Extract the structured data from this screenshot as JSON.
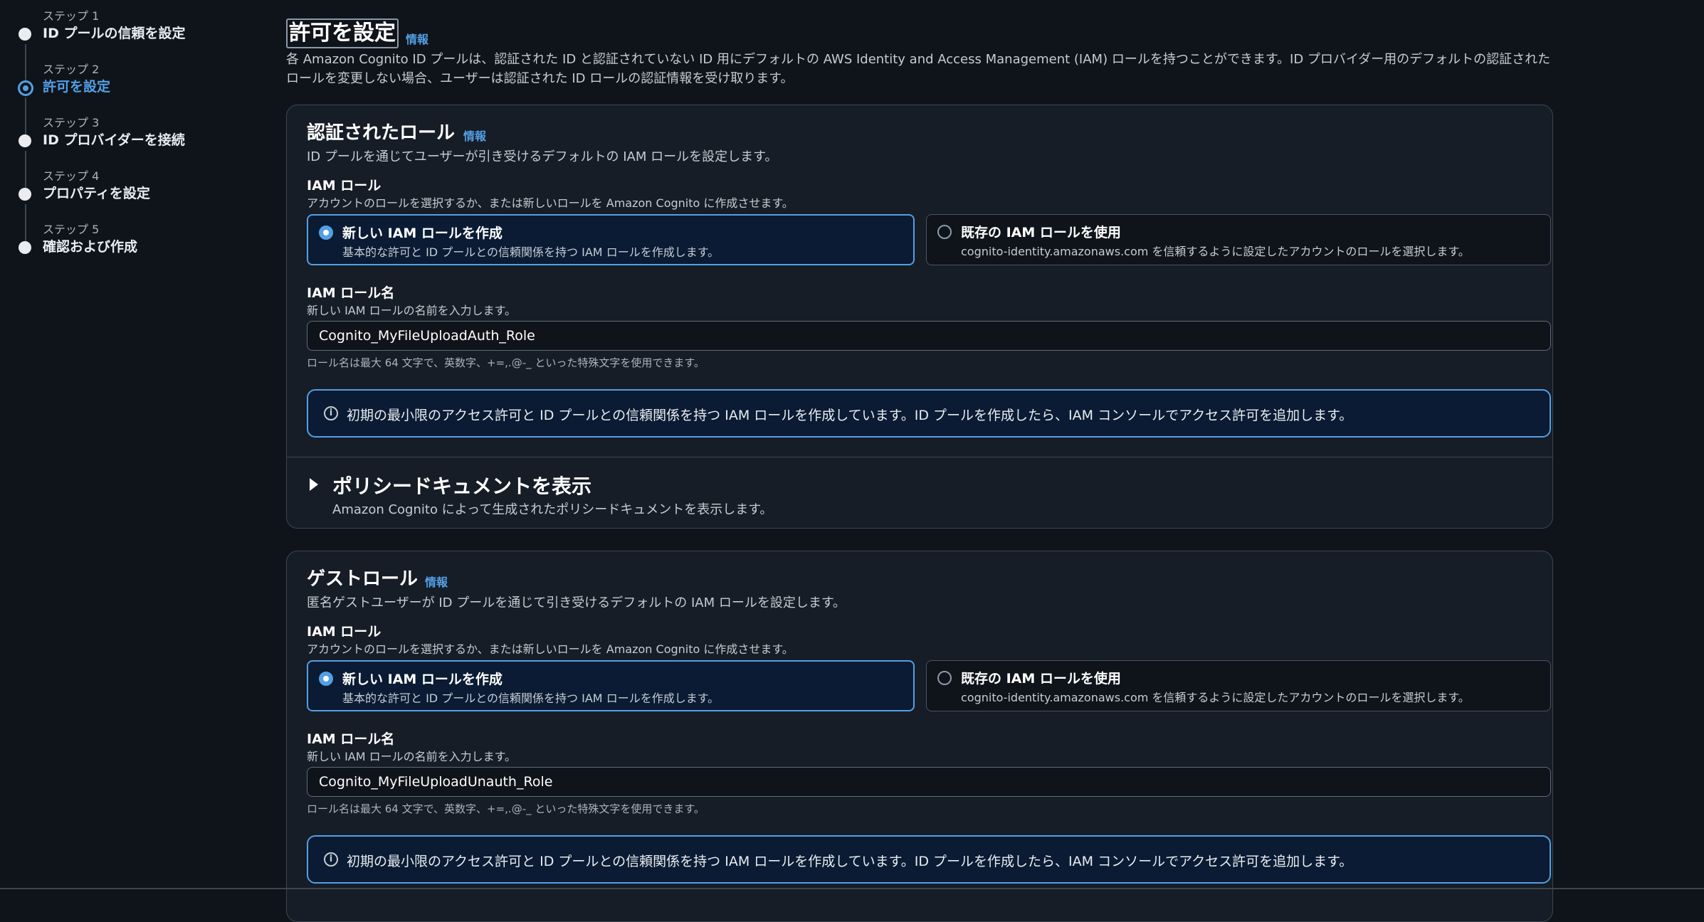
{
  "steps": [
    {
      "label": "ステップ 1",
      "name": "ID プールの信頼を設定"
    },
    {
      "label": "ステップ 2",
      "name": "許可を設定"
    },
    {
      "label": "ステップ 3",
      "name": "ID プロバイダーを接続"
    },
    {
      "label": "ステップ 4",
      "name": "プロパティを設定"
    },
    {
      "label": "ステップ 5",
      "name": "確認および作成"
    }
  ],
  "header": {
    "title": "許可を設定",
    "info": "情報",
    "description": "各 Amazon Cognito ID プールは、認証された ID と認証されていない ID 用にデフォルトの AWS Identity and Access Management (IAM) ロールを持つことができます。ID プロバイダー用のデフォルトの認証されたロールを変更しない場合、ユーザーは認証された ID ロールの認証情報を受け取ります。"
  },
  "auth_role": {
    "title": "認証されたロール",
    "info": "情報",
    "description": "ID プールを通じてユーザーが引き受けるデフォルトの IAM ロールを設定します。",
    "iam_role_label": "IAM ロール",
    "iam_role_desc": "アカウントのロールを選択するか、または新しいロールを Amazon Cognito に作成させます。",
    "option_new_title": "新しい IAM ロールを作成",
    "option_new_desc": "基本的な許可と ID プールとの信頼関係を持つ IAM ロールを作成します。",
    "option_existing_title": "既存の IAM ロールを使用",
    "option_existing_desc": "cognito-identity.amazonaws.com を信頼するように設定したアカウントのロールを選択します。",
    "role_name_label": "IAM ロール名",
    "role_name_desc": "新しい IAM ロールの名前を入力します。",
    "role_name_value": "Cognito_MyFileUploadAuth_Role",
    "role_name_hint": "ロール名は最大 64 文字で、英数字、+=,.@-_ といった特殊文字を使用できます。",
    "alert": "初期の最小限のアクセス許可と ID プールとの信頼関係を持つ IAM ロールを作成しています。ID プールを作成したら、IAM コンソールでアクセス許可を追加します。",
    "policy_title": "ポリシードキュメントを表示",
    "policy_desc": "Amazon Cognito によって生成されたポリシードキュメントを表示します。"
  },
  "guest_role": {
    "title": "ゲストロール",
    "info": "情報",
    "description": "匿名ゲストユーザーが ID プールを通じて引き受けるデフォルトの IAM ロールを設定します。",
    "iam_role_label": "IAM ロール",
    "iam_role_desc": "アカウントのロールを選択するか、または新しいロールを Amazon Cognito に作成させます。",
    "option_new_title": "新しい IAM ロールを作成",
    "option_new_desc": "基本的な許可と ID プールとの信頼関係を持つ IAM ロールを作成します。",
    "option_existing_title": "既存の IAM ロールを使用",
    "option_existing_desc": "cognito-identity.amazonaws.com を信頼するように設定したアカウントのロールを選択します。",
    "role_name_label": "IAM ロール名",
    "role_name_desc": "新しい IAM ロールの名前を入力します。",
    "role_name_value": "Cognito_MyFileUploadUnauth_Role",
    "role_name_hint": "ロール名は最大 64 文字で、英数字、+=,.@-_ といった特殊文字を使用できます。",
    "alert": "初期の最小限のアクセス許可と ID プールとの信頼関係を持つ IAM ロールを作成しています。ID プールを作成したら、IAM コンソールでアクセス許可を追加します。"
  },
  "colors": {
    "accent": "#539fe5",
    "background": "#0f141a",
    "card": "#161d26"
  }
}
